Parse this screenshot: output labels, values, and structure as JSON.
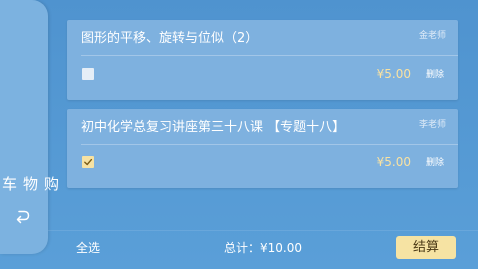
{
  "sidebar": {
    "title": "购物车",
    "back_icon": "return-arrow-icon"
  },
  "cart": {
    "items": [
      {
        "title": "图形的平移、旋转与位似（2）",
        "teacher": "金老师",
        "price": "¥5.00",
        "delete_label": "删除",
        "checked": false
      },
      {
        "title": "初中化学总复习讲座第三十八课 【专题十八】",
        "teacher": "李老师",
        "price": "¥5.00",
        "delete_label": "删除",
        "checked": true
      }
    ]
  },
  "footer": {
    "select_all_label": "全选",
    "total_text": "总计：¥10.00",
    "checkout_label": "结算"
  },
  "colors": {
    "background": "#5598d5",
    "card": "#7eb1df",
    "accent": "#f6e3a3",
    "price": "#f9e2a2"
  }
}
